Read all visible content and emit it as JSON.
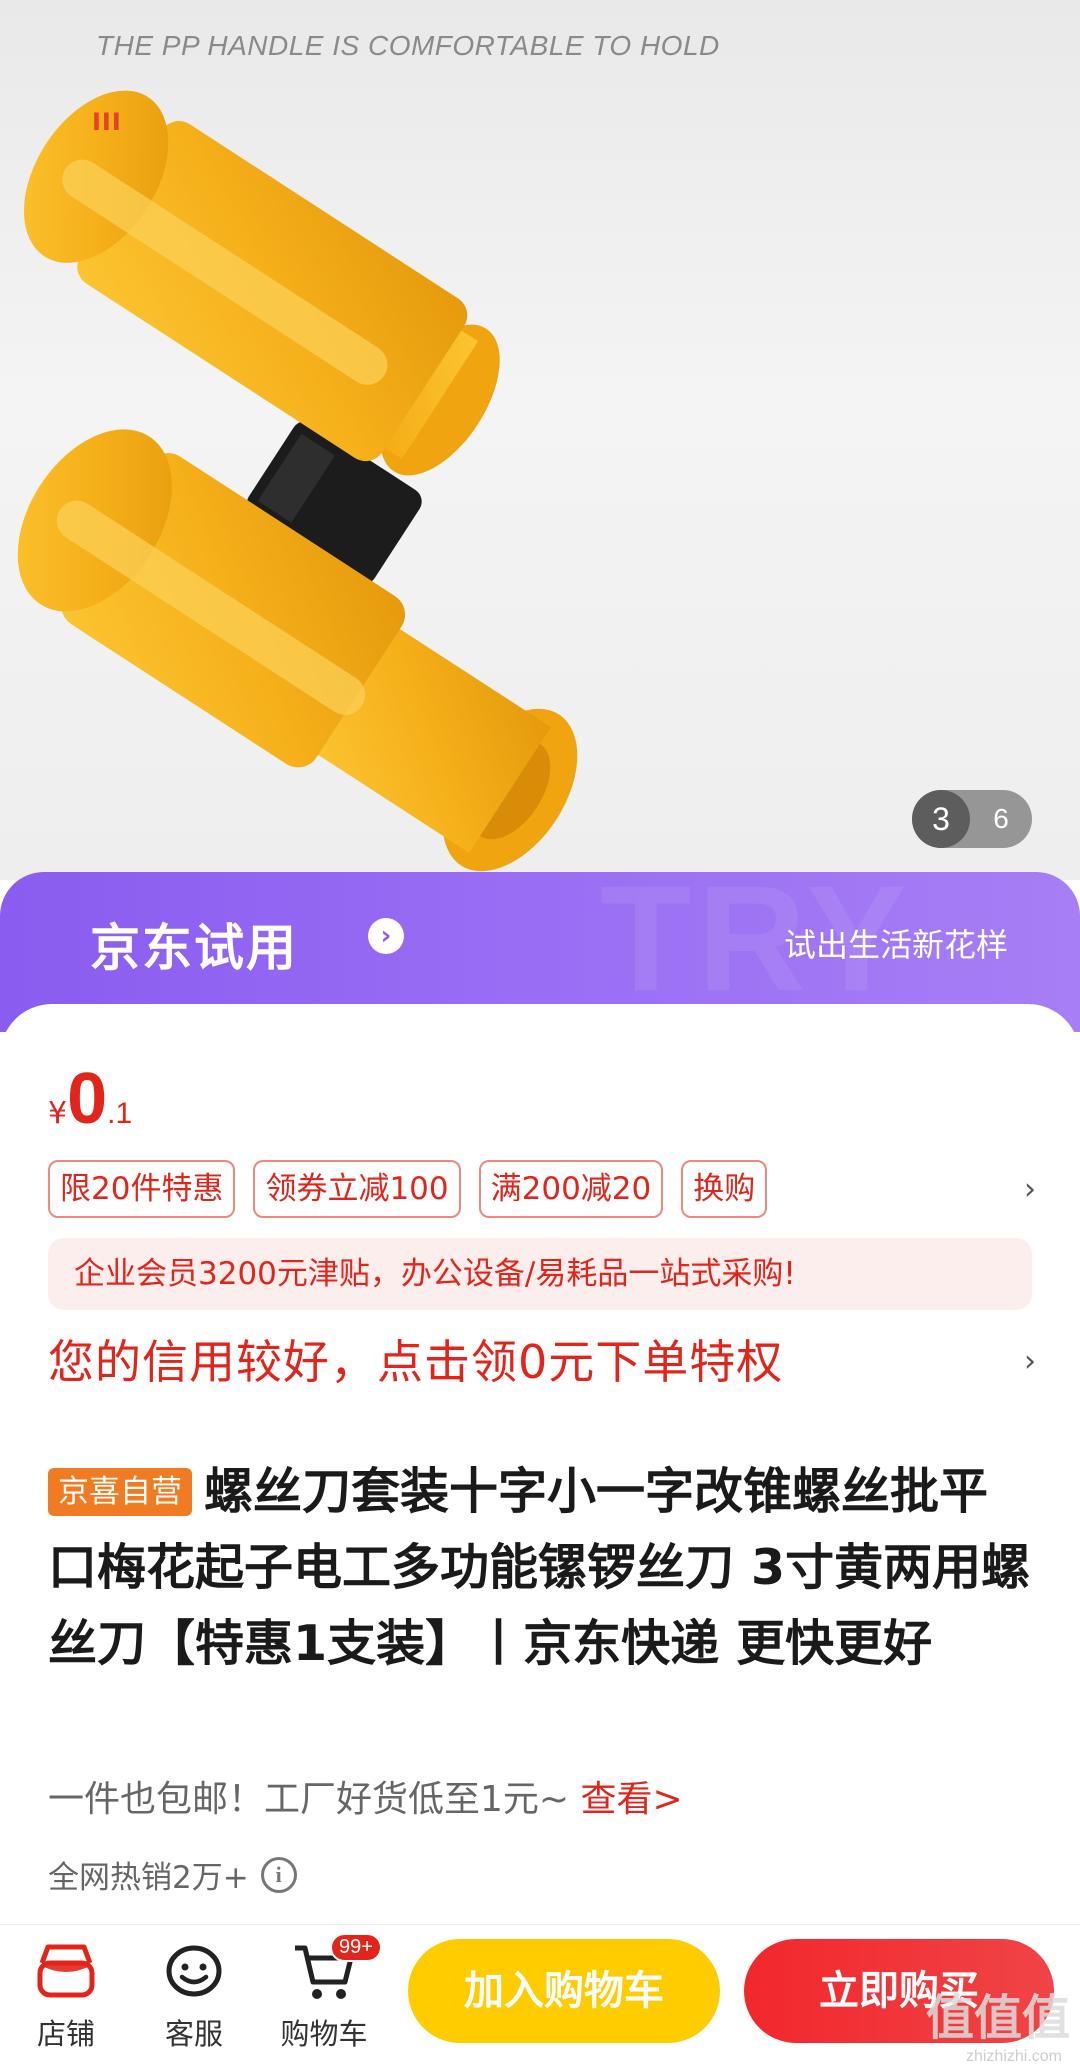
{
  "hero": {
    "caption": "THE PP HANDLE IS COMFORTABLE TO HOLD",
    "marks": "III",
    "pager_current": "3",
    "pager_total": "6"
  },
  "trial": {
    "title": "京东试用",
    "arrow": "›",
    "slogan": "试出生活新花样",
    "watermark": "TRY"
  },
  "price": {
    "symbol": "¥",
    "integer": "0",
    "decimal": ".1"
  },
  "promo_tags": [
    "限20件特惠",
    "领券立减100",
    "满200减20",
    "换购"
  ],
  "chevron": "›",
  "enterprise_banner": "企业会员3200元津贴，办公设备/易耗品一站式采购!",
  "credit_line": "您的信用较好，点击领0元下单特权",
  "product": {
    "badge": "京喜自营",
    "title": "螺丝刀套装十字小一字改锥螺丝批平口梅花起子电工多功能镙锣丝刀 3寸黄两用螺丝刀【特惠1支装】丨京东快递 更快更好"
  },
  "subtitle": {
    "text": "一件也包邮！工厂好货低至1元~ ",
    "link": "查看>"
  },
  "sales": "全网热销2万+",
  "info_icon": "i",
  "bottom_bar": {
    "store": "店铺",
    "service": "客服",
    "cart": "购物车",
    "cart_badge": "99+",
    "add_to_cart": "加入购物车",
    "buy_now": "立即购买"
  },
  "watermark": {
    "big": "值值值",
    "small": "zhizhizhi.com"
  },
  "colors": {
    "accent_red": "#e1251b",
    "trial_purple": "#8a5cf0",
    "cart_yellow": "#ffcc00",
    "badge_orange": "#f17b22",
    "handle_yellow": "#f7b21b"
  }
}
